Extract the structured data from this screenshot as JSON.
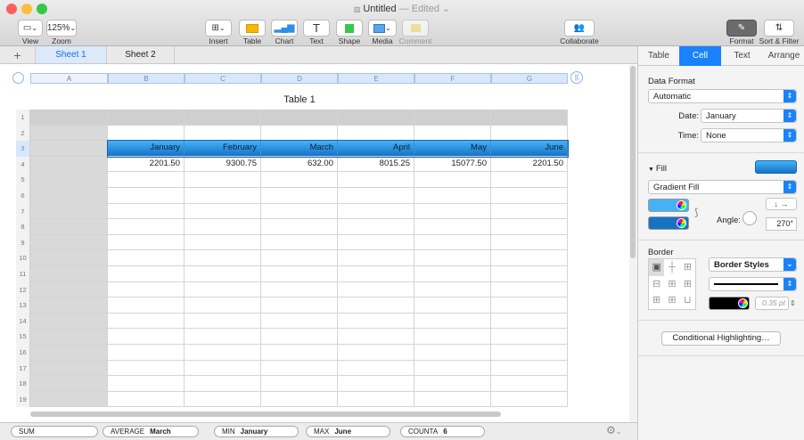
{
  "window": {
    "doc_name": "Untitled",
    "edited": "— Edited",
    "colors": {
      "close": "#fc605c",
      "min": "#fdbc40",
      "max": "#34c84a",
      "accent": "#1a82fb"
    }
  },
  "toolbar": {
    "view_label": "View",
    "zoom_value": "125%",
    "zoom_label": "Zoom",
    "insert_label": "Insert",
    "table_label": "Table",
    "chart_label": "Chart",
    "text_label": "Text",
    "shape_label": "Shape",
    "media_label": "Media",
    "comment_label": "Comment",
    "collaborate_label": "Collaborate",
    "format_label": "Format",
    "sort_filter_label": "Sort & Filter"
  },
  "sheets": {
    "add_symbol": "+",
    "tabs": [
      {
        "label": "Sheet 1",
        "active": true
      },
      {
        "label": "Sheet 2",
        "active": false
      }
    ]
  },
  "table": {
    "title": "Table 1",
    "column_letters": [
      "A",
      "B",
      "C",
      "D",
      "E",
      "F",
      "G"
    ],
    "row_numbers": [
      "1",
      "2",
      "3",
      "4",
      "5",
      "6",
      "7",
      "8",
      "9",
      "10",
      "11",
      "12",
      "13",
      "14",
      "15",
      "16",
      "17",
      "18",
      "19"
    ],
    "header_row": [
      "",
      "January",
      "February",
      "March",
      "April",
      "May",
      "June"
    ],
    "data_row": [
      "",
      "2201.50",
      "9300.75",
      "632.00",
      "8015.25",
      "15077.50",
      "2201.50"
    ]
  },
  "panel": {
    "tabs": [
      "Table",
      "Cell",
      "Text",
      "Arrange"
    ],
    "active_tab": "Cell",
    "data_format_label": "Data Format",
    "data_format_value": "Automatic",
    "date_label": "Date:",
    "date_value": "January",
    "time_label": "Time:",
    "time_value": "None",
    "fill_label": "Fill",
    "fill_type": "Gradient Fill",
    "angle_label": "Angle:",
    "angle_value": "270°",
    "border_label": "Border",
    "border_styles": "Border Styles",
    "border_width": "0.35 pt",
    "conditional_button": "Conditional Highlighting…",
    "gradient_top": "#45b2f7",
    "gradient_bottom": "#1673c4"
  },
  "status": {
    "items": [
      {
        "label": "SUM",
        "value": ""
      },
      {
        "label": "AVERAGE",
        "value": "March"
      },
      {
        "label": "MIN",
        "value": "January"
      },
      {
        "label": "MAX",
        "value": "June"
      },
      {
        "label": "COUNTA",
        "value": "6"
      }
    ]
  }
}
